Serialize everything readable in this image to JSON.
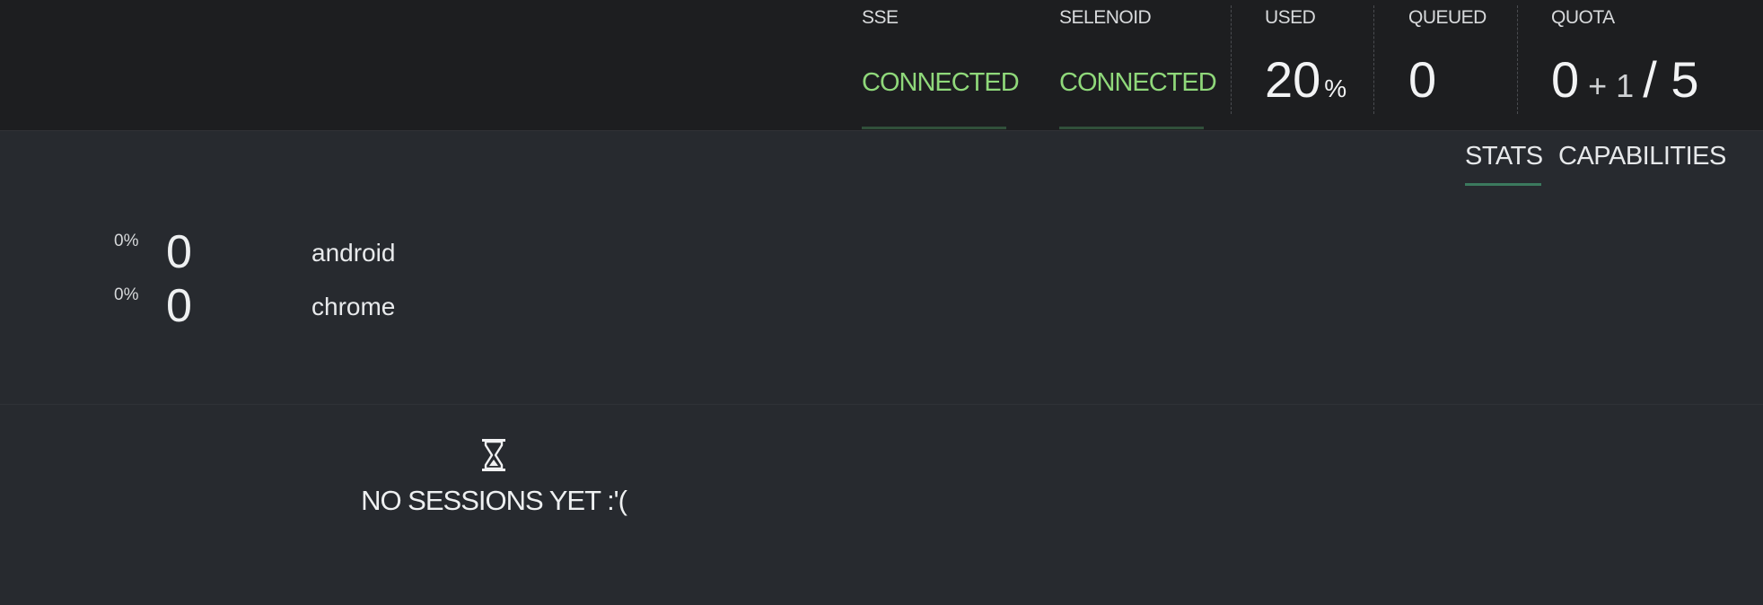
{
  "status": {
    "sse": {
      "label": "SSE",
      "state": "CONNECTED"
    },
    "selenoid": {
      "label": "SELENOID",
      "state": "CONNECTED"
    },
    "used": {
      "label": "USED",
      "value": "20",
      "unit": "%"
    },
    "queued": {
      "label": "QUEUED",
      "value": "0"
    },
    "quota": {
      "label": "QUOTA",
      "used": "0",
      "plus": "+ 1",
      "total": "/ 5"
    }
  },
  "tabs": [
    {
      "label": "STATS",
      "active": true
    },
    {
      "label": "CAPABILITIES",
      "active": false
    }
  ],
  "browsers": [
    {
      "percent": "0%",
      "count": "0",
      "name": "android"
    },
    {
      "percent": "0%",
      "count": "0",
      "name": "chrome"
    }
  ],
  "sessions": {
    "icon": "hourglass-icon",
    "empty_text": "NO SESSIONS YET :'("
  },
  "colors": {
    "connected": "#8fd87a",
    "accent_underline": "#3b7a5e",
    "topbar_bg": "#1d1e20",
    "page_bg": "#272a2f"
  }
}
